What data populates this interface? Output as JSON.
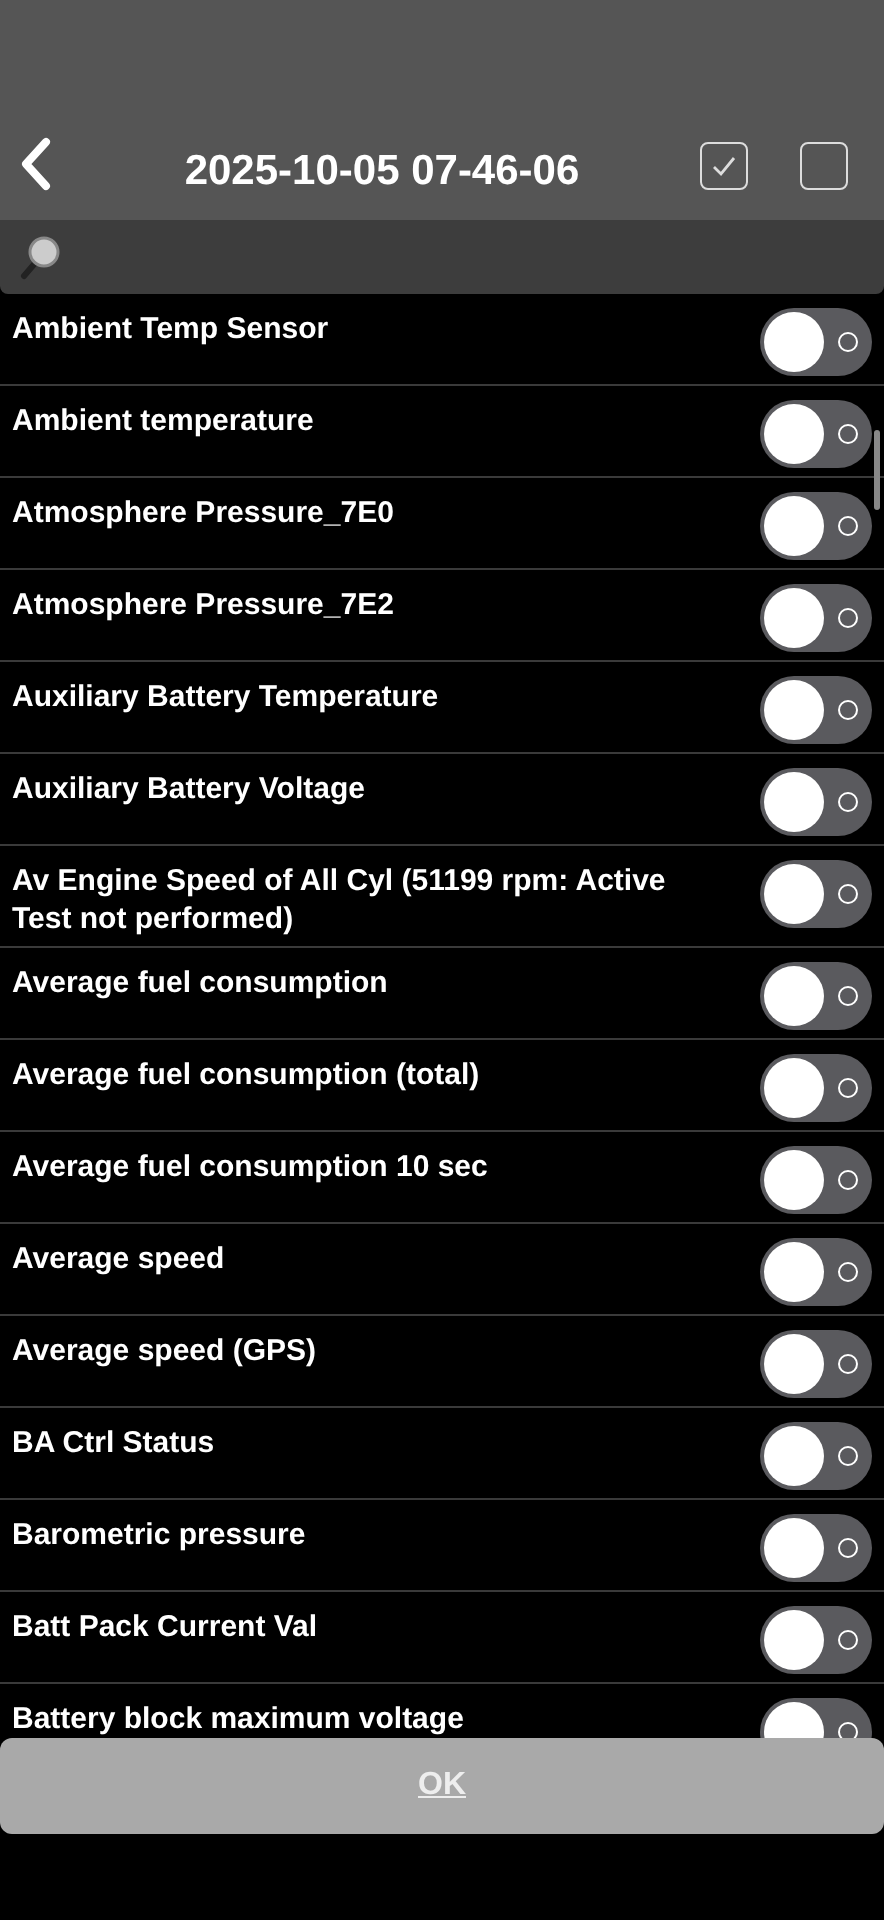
{
  "header": {
    "title": "2025-10-05 07-46-06",
    "checkboxes": [
      {
        "checked": true
      },
      {
        "checked": false
      }
    ]
  },
  "items": [
    {
      "label": "Ambient Temp Sensor",
      "on": false
    },
    {
      "label": "Ambient temperature",
      "on": false
    },
    {
      "label": "Atmosphere Pressure_7E0",
      "on": false
    },
    {
      "label": "Atmosphere Pressure_7E2",
      "on": false
    },
    {
      "label": "Auxiliary Battery Temperature",
      "on": false
    },
    {
      "label": "Auxiliary Battery Voltage",
      "on": false
    },
    {
      "label": "Av Engine Speed of All Cyl (51199 rpm: Active Test not performed)",
      "on": false
    },
    {
      "label": "Average fuel consumption",
      "on": false
    },
    {
      "label": "Average fuel consumption (total)",
      "on": false
    },
    {
      "label": "Average fuel consumption 10 sec",
      "on": false
    },
    {
      "label": "Average speed",
      "on": false
    },
    {
      "label": "Average speed (GPS)",
      "on": false
    },
    {
      "label": "BA Ctrl Status",
      "on": false
    },
    {
      "label": "Barometric pressure",
      "on": false
    },
    {
      "label": "Batt Pack Current Val",
      "on": false
    },
    {
      "label": "Battery block maximum voltage",
      "on": false
    }
  ],
  "ok_button": {
    "label": "OK",
    "disabled": true
  }
}
